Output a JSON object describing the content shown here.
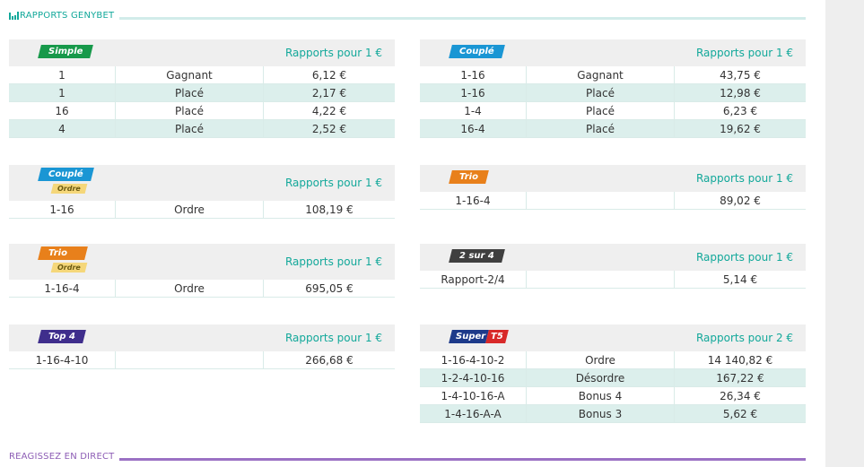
{
  "section_title": "RAPPORTS GENYBET",
  "section_footer": "REAGISSEZ EN DIRECT",
  "colors": {
    "teal": "#12a89a",
    "simple": "#17994a",
    "couple": "#1a96d4",
    "trio": "#e8801b",
    "sur4": "#3f3f3f",
    "top4": "#3f2e8c",
    "super": "#1d3a8a",
    "t5": "#d82929",
    "ordre_sub": "#f5d77a"
  },
  "tables": {
    "simple": {
      "badge": "Simple",
      "rapport": "Rapports pour 1 €",
      "rows": [
        [
          "1",
          "Gagnant",
          "6,12 €"
        ],
        [
          "1",
          "Placé",
          "2,17 €"
        ],
        [
          "16",
          "Placé",
          "4,22 €"
        ],
        [
          "4",
          "Placé",
          "2,52 €"
        ]
      ]
    },
    "couple": {
      "badge": "Couplé",
      "rapport": "Rapports pour 1 €",
      "rows": [
        [
          "1-16",
          "Gagnant",
          "43,75 €"
        ],
        [
          "1-16",
          "Placé",
          "12,98 €"
        ],
        [
          "1-4",
          "Placé",
          "6,23 €"
        ],
        [
          "16-4",
          "Placé",
          "19,62 €"
        ]
      ]
    },
    "couple_ordre": {
      "badge": "Couplé",
      "sub_badge": "Ordre",
      "rapport": "Rapports pour 1 €",
      "rows": [
        [
          "1-16",
          "Ordre",
          "108,19 €"
        ]
      ]
    },
    "trio": {
      "badge": "Trio",
      "rapport": "Rapports pour 1 €",
      "rows": [
        [
          "1-16-4",
          "",
          "89,02 €"
        ]
      ]
    },
    "trio_ordre": {
      "badge": "Trio",
      "sub_badge": "Ordre",
      "rapport": "Rapports pour 1 €",
      "rows": [
        [
          "1-16-4",
          "Ordre",
          "695,05 €"
        ]
      ]
    },
    "deux_sur_4": {
      "badge": "2 sur 4",
      "rapport": "Rapports pour 1 €",
      "rows": [
        [
          "Rapport-2/4",
          "",
          "5,14 €"
        ]
      ]
    },
    "top4": {
      "badge": "Top 4",
      "rapport": "Rapports pour 1 €",
      "rows": [
        [
          "1-16-4-10",
          "",
          "266,68 €"
        ]
      ]
    },
    "super_t5": {
      "badge_a": "Super",
      "badge_b": "T5",
      "rapport": "Rapports pour 2 €",
      "rows": [
        [
          "1-16-4-10-2",
          "Ordre",
          "14 140,82 €"
        ],
        [
          "1-2-4-10-16",
          "Désordre",
          "167,22 €"
        ],
        [
          "1-4-10-16-A",
          "Bonus 4",
          "26,34 €"
        ],
        [
          "1-4-16-A-A",
          "Bonus 3",
          "5,62 €"
        ]
      ]
    }
  }
}
